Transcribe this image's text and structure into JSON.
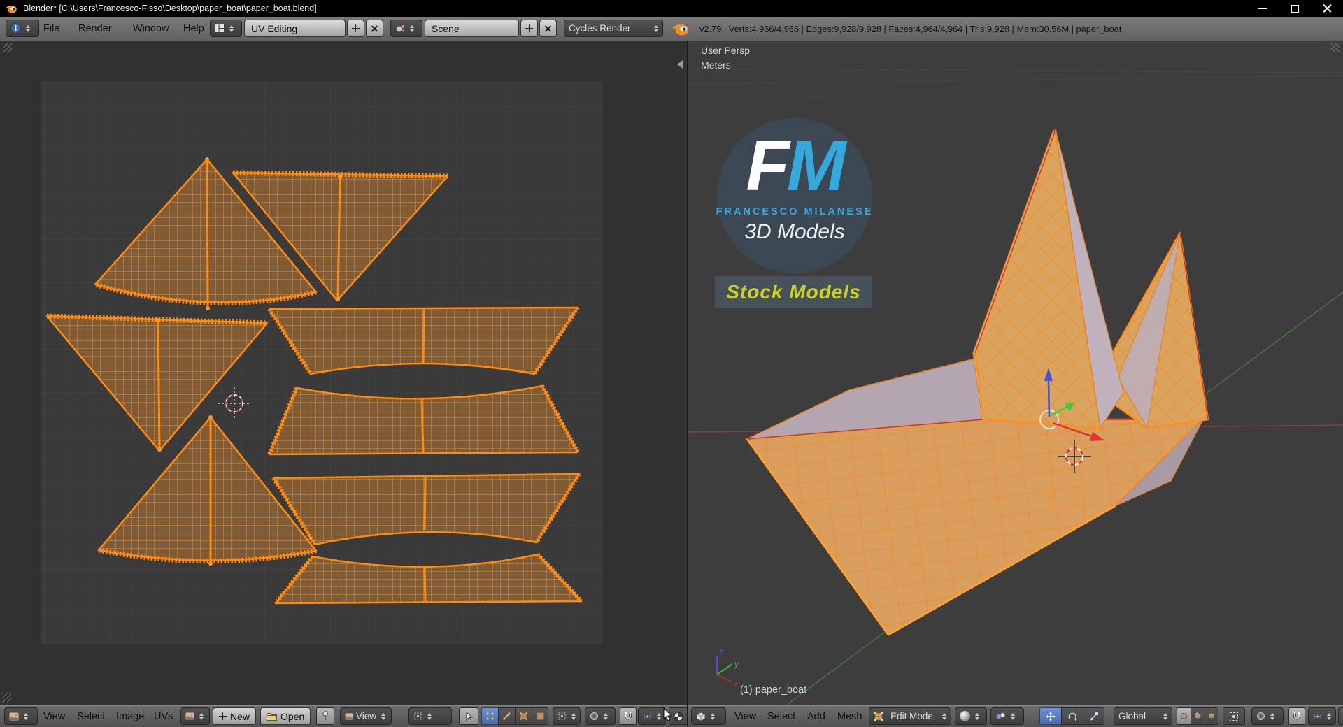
{
  "window": {
    "title": "Blender* [C:\\Users\\Francesco-Fisso\\Desktop\\paper_boat\\paper_boat.blend]"
  },
  "info_bar": {
    "menus": [
      "File",
      "Render",
      "Window",
      "Help"
    ],
    "layout_field": "UV Editing",
    "scene_field": "Scene",
    "engine_field": "Cycles Render",
    "stats": "v2.79 | Verts:4,966/4,966 | Edges:9,928/9,928 | Faces:4,964/4,964 | Tris:9,928 | Mem:30.56M | paper_boat"
  },
  "uv_editor": {
    "menus": [
      "View",
      "Select",
      "Image",
      "UVs"
    ],
    "new_button": "New",
    "open_button": "Open",
    "display_dropdown": "View"
  },
  "viewport": {
    "view_label": "User Persp",
    "units_label": "Meters",
    "object_info": "(1) paper_boat",
    "menus": [
      "View",
      "Select",
      "Add",
      "Mesh"
    ],
    "mode_dropdown": "Edit Mode",
    "orientation_dropdown": "Global",
    "axis_gizmo": {
      "x": "x",
      "y": "y",
      "z": "z"
    }
  },
  "watermark": {
    "initial_f": "F",
    "initial_m": "M",
    "name": "FRANCESCO MILANESE",
    "tagline": "3D Models",
    "banner": "Stock Models"
  },
  "colors": {
    "accent_orange": "#ff8c00",
    "logo_blue": "#35a9dc",
    "banner_yellow": "#c9d41f",
    "select_blue": "#5680c2"
  }
}
